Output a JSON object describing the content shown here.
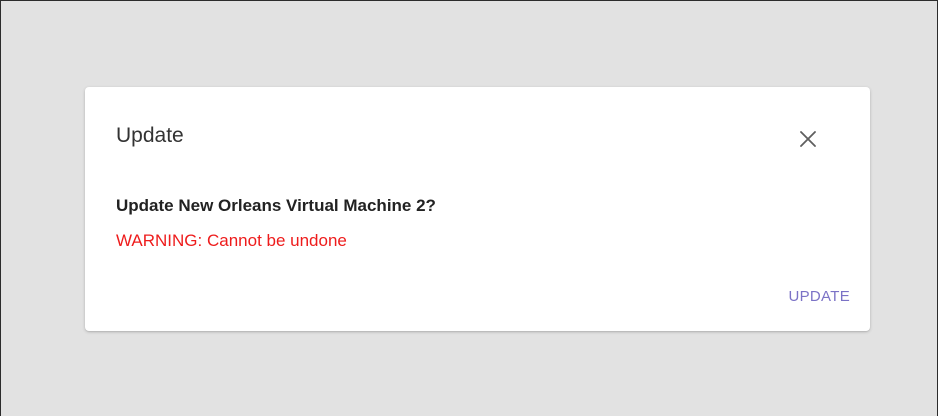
{
  "dialog": {
    "title": "Update",
    "message": "Update New Orleans Virtual Machine 2?",
    "warning": "WARNING: Cannot be undone",
    "confirm_label": "UPDATE",
    "close_icon": "close-icon"
  },
  "colors": {
    "backdrop": "#e2e2e2",
    "warning": "#ee1c1c",
    "accent": "#7b72c6",
    "dialog_bg": "#ffffff"
  }
}
